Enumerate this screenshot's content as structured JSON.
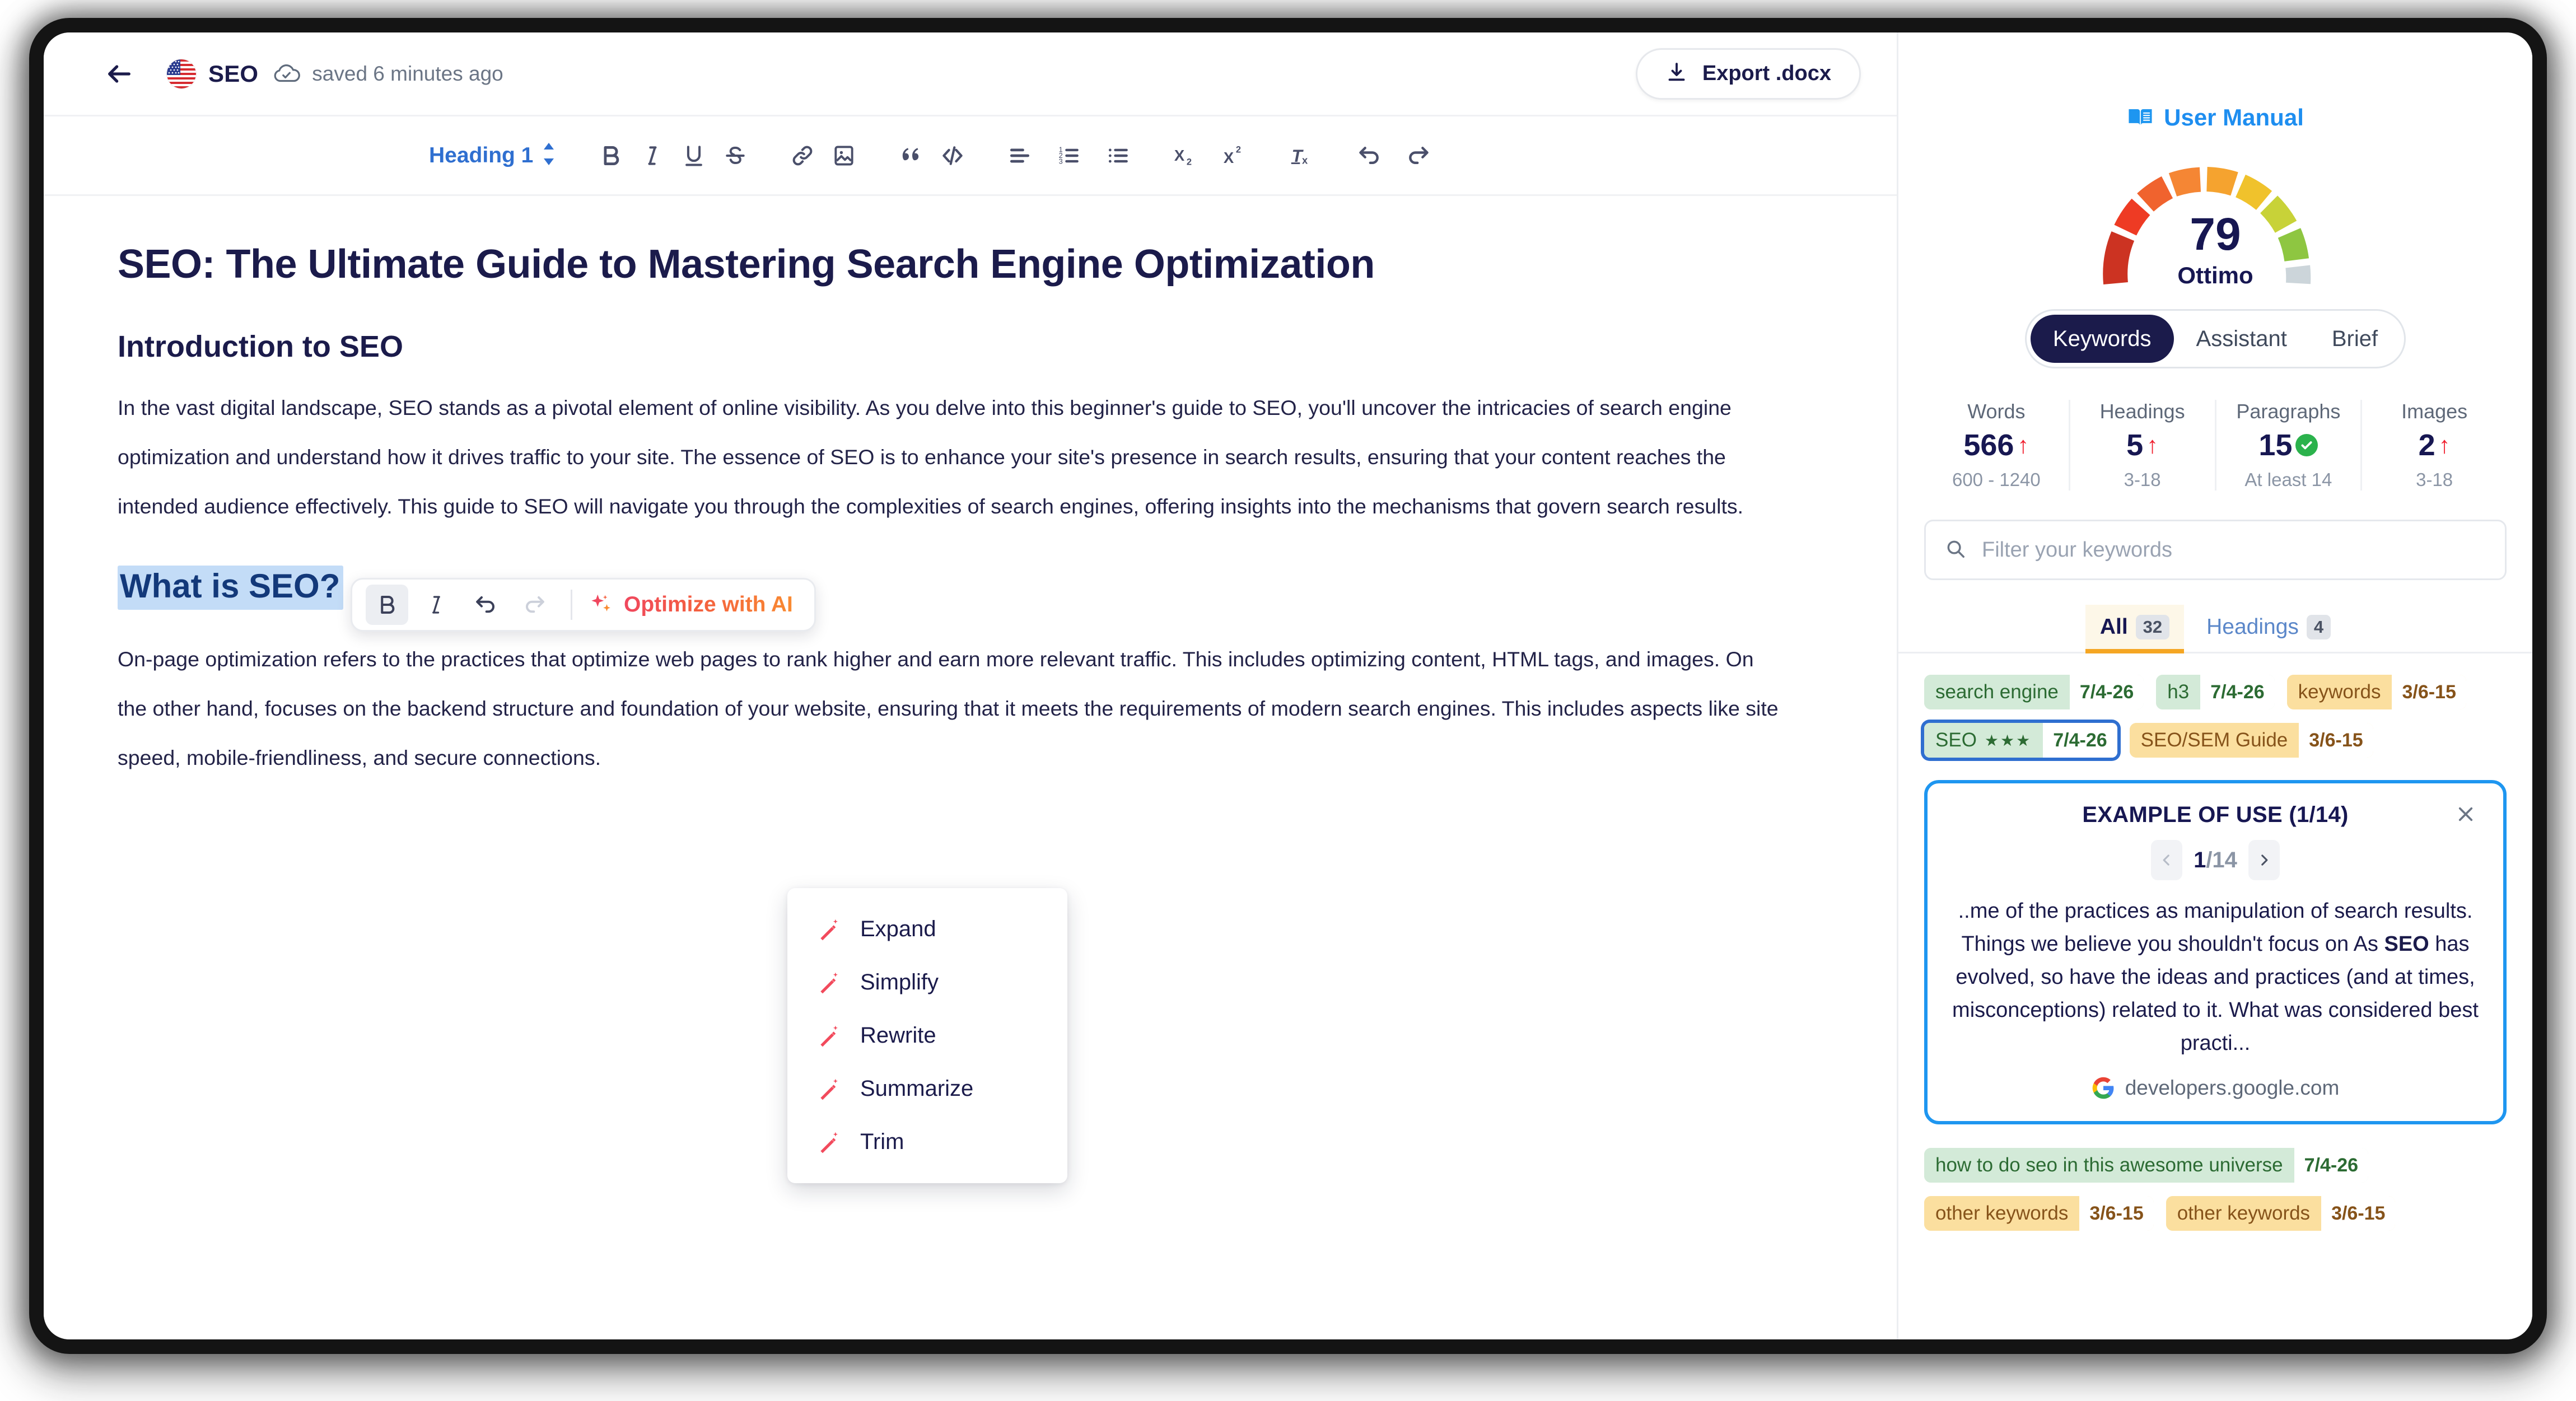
{
  "header": {
    "back_icon": "back-arrow-icon",
    "flag_icon": "us-flag-icon",
    "doc_title": "SEO",
    "cloud_icon": "cloud-check-icon",
    "saved_status": "saved 6 minutes ago",
    "export_label": "Export .docx",
    "export_icon": "download-icon"
  },
  "toolbar": {
    "heading_label": "Heading 1",
    "buttons": [
      {
        "name": "bold-button",
        "icon": "bold-icon"
      },
      {
        "name": "italic-button",
        "icon": "italic-icon"
      },
      {
        "name": "underline-button",
        "icon": "underline-icon"
      },
      {
        "name": "strikethrough-button",
        "icon": "strikethrough-icon"
      },
      {
        "name": "link-button",
        "icon": "link-icon"
      },
      {
        "name": "image-button",
        "icon": "image-icon"
      },
      {
        "name": "quote-button",
        "icon": "quote-icon"
      },
      {
        "name": "code-button",
        "icon": "code-icon"
      },
      {
        "name": "align-button",
        "icon": "align-left-icon"
      },
      {
        "name": "ordered-list-button",
        "icon": "ordered-list-icon"
      },
      {
        "name": "bullet-list-button",
        "icon": "bullet-list-icon"
      },
      {
        "name": "subscript-button",
        "icon": "subscript-icon"
      },
      {
        "name": "superscript-button",
        "icon": "superscript-icon"
      },
      {
        "name": "clear-format-button",
        "icon": "clear-format-icon"
      },
      {
        "name": "undo-button",
        "icon": "undo-icon"
      },
      {
        "name": "redo-button",
        "icon": "redo-icon"
      }
    ]
  },
  "document": {
    "h1": "SEO: The Ultimate Guide to Mastering Search Engine Optimization",
    "h2_intro": "Introduction to SEO",
    "paragraph1": "In the vast digital landscape, SEO stands as a pivotal element of online visibility. As you delve into this beginner's guide to SEO, you'll uncover the intricacies of search engine optimization and understand how it drives traffic to your site. The essence of SEO is to enhance your site's presence in search results, ensuring that your content reaches the intended audience effectively. This guide to SEO will navigate you through the complexities of search engines, offering insights into the mechanisms that govern search results.",
    "h2_selected": "What is SEO?",
    "paragraph2": "On-page optimization refers to the practices that optimize web pages to rank higher and earn more relevant traffic. This includes optimizing content, HTML tags, and images. On the other hand, focuses on the backend structure and foundation of your website, ensuring that it meets the requirements of modern search engines. This includes aspects like site speed, mobile-friendliness, and secure connections."
  },
  "selection_toolbar": {
    "bold_icon": "bold-icon",
    "italic_icon": "italic-icon",
    "undo_icon": "undo-icon",
    "redo_icon": "redo-icon",
    "optimize_label": "Optimize with AI",
    "sparkle_icon": "sparkles-icon"
  },
  "ai_menu": {
    "items": [
      {
        "label": "Expand",
        "icon": "magic-wand-icon"
      },
      {
        "label": "Simplify",
        "icon": "magic-wand-icon"
      },
      {
        "label": "Rewrite",
        "icon": "magic-wand-icon"
      },
      {
        "label": "Summarize",
        "icon": "magic-wand-icon"
      },
      {
        "label": "Trim",
        "icon": "magic-wand-icon"
      }
    ]
  },
  "panel": {
    "manual_label": "User Manual",
    "manual_icon": "open-book-icon",
    "gauge": {
      "score": "79",
      "label": "Ottimo",
      "filled_segments": 8,
      "total_segments": 9,
      "colors": [
        "#cc3322",
        "#ee3b24",
        "#f0632e",
        "#f58634",
        "#f5a32f",
        "#f0c22c",
        "#c8d238",
        "#8ec641",
        "#ccd5da"
      ]
    },
    "tabs": [
      {
        "label": "Keywords",
        "active": true
      },
      {
        "label": "Assistant",
        "active": false
      },
      {
        "label": "Brief",
        "active": false
      }
    ],
    "stats": [
      {
        "label": "Words",
        "value": "566",
        "indicator": "arrow-up",
        "range": "600 - 1240"
      },
      {
        "label": "Headings",
        "value": "5",
        "indicator": "arrow-up",
        "range": "3-18"
      },
      {
        "label": "Paragraphs",
        "value": "15",
        "indicator": "check",
        "range": "At least 14"
      },
      {
        "label": "Images",
        "value": "2",
        "indicator": "arrow-up",
        "range": "3-18"
      }
    ],
    "search": {
      "placeholder": "Filter your keywords",
      "value": "",
      "icon": "search-icon"
    },
    "filter_tabs": [
      {
        "label": "All",
        "badge": "32",
        "active": true
      },
      {
        "label": "Headings",
        "badge": "4",
        "active": false
      }
    ],
    "chips_top": [
      [
        {
          "name": "search engine",
          "count": "7/4-26",
          "color": "green",
          "stars": "",
          "selected": false
        },
        {
          "name": "h3",
          "count": "7/4-26",
          "color": "green",
          "stars": "",
          "selected": false
        },
        {
          "name": "keywords",
          "count": "3/6-15",
          "color": "yellow",
          "stars": "",
          "selected": false
        }
      ],
      [
        {
          "name": "SEO",
          "count": "7/4-26",
          "color": "green",
          "stars": "★★★",
          "selected": true
        },
        {
          "name": "SEO/SEM Guide",
          "count": "3/6-15",
          "color": "yellow",
          "stars": "",
          "selected": false
        }
      ]
    ],
    "example_card": {
      "title": "EXAMPLE OF USE (1/14)",
      "close_icon": "close-icon",
      "prev_icon": "chevron-left-icon",
      "next_icon": "chevron-right-icon",
      "counter_current": "1",
      "counter_total": "/14",
      "text_before": "..me of the practices as manipulation of search results. Things we believe you shouldn't focus on As ",
      "text_highlight": "SEO",
      "text_after": " has evolved, so have the ideas and practices (and at times, misconceptions) related to it. What was considered best practi...",
      "source": "developers.google.com",
      "source_icon": "google-icon"
    },
    "chips_bottom": [
      [
        {
          "name": "how to do seo in this awesome universe",
          "count": "7/4-26",
          "color": "green",
          "stars": "",
          "selected": false
        }
      ],
      [
        {
          "name": "other keywords",
          "count": "3/6-15",
          "color": "yellow",
          "stars": "",
          "selected": false
        },
        {
          "name": "other keywords",
          "count": "3/6-15",
          "color": "yellow",
          "stars": "",
          "selected": false
        }
      ]
    ]
  },
  "colors": {
    "brand_dark": "#1b1b4b",
    "accent_blue": "#1e96f0",
    "accent_orange": "#f5a623",
    "danger_red": "#f01f2e",
    "success_green": "#2bb24c"
  }
}
